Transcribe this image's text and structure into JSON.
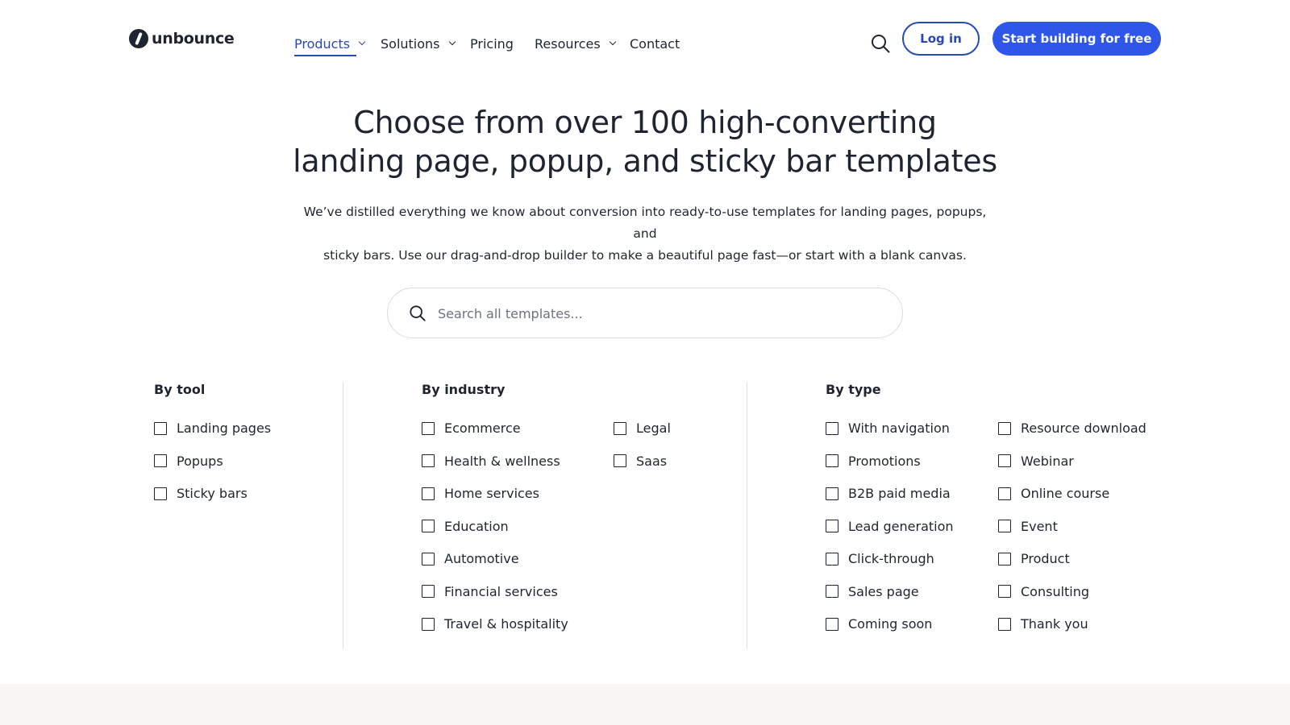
{
  "brand": {
    "name": "unbounce"
  },
  "nav": {
    "items": [
      {
        "label": "Products",
        "dropdown": true,
        "active": true
      },
      {
        "label": "Solutions",
        "dropdown": true
      },
      {
        "label": "Pricing",
        "dropdown": false
      },
      {
        "label": "Resources",
        "dropdown": true
      },
      {
        "label": "Contact",
        "dropdown": false
      }
    ],
    "login_label": "Log in",
    "start_label": "Start building for free"
  },
  "hero": {
    "title_line1": "Choose from over 100 high-converting",
    "title_line2": "landing page, popup, and sticky bar templates",
    "subtitle_line1": "We’ve distilled everything we know about conversion into ready-to-use templates for landing pages, popups, and",
    "subtitle_line2": "sticky bars. Use our drag-and-drop builder to make a beautiful page fast—or start with a blank canvas."
  },
  "search": {
    "placeholder": "Search all templates...",
    "value": ""
  },
  "filters": {
    "by_tool": {
      "title": "By tool",
      "items": [
        "Landing pages",
        "Popups",
        "Sticky bars"
      ]
    },
    "by_industry": {
      "title": "By industry",
      "items_col1": [
        "Ecommerce",
        "Health & wellness",
        "Home services",
        "Education",
        "Automotive",
        "Financial services",
        "Travel & hospitality"
      ],
      "items_col2": [
        "Legal",
        "Saas"
      ]
    },
    "by_type": {
      "title": "By type",
      "items_col1": [
        "With navigation",
        "Promotions",
        "B2B paid media",
        "Lead generation",
        "Click-through",
        "Sales page",
        "Coming soon"
      ],
      "items_col2": [
        "Resource download",
        "Webinar",
        "Online course",
        "Event",
        "Product",
        "Consulting",
        "Thank you"
      ]
    }
  },
  "colors": {
    "accent": "#2e56e8",
    "link": "#2949b5",
    "text": "#1f2530"
  }
}
